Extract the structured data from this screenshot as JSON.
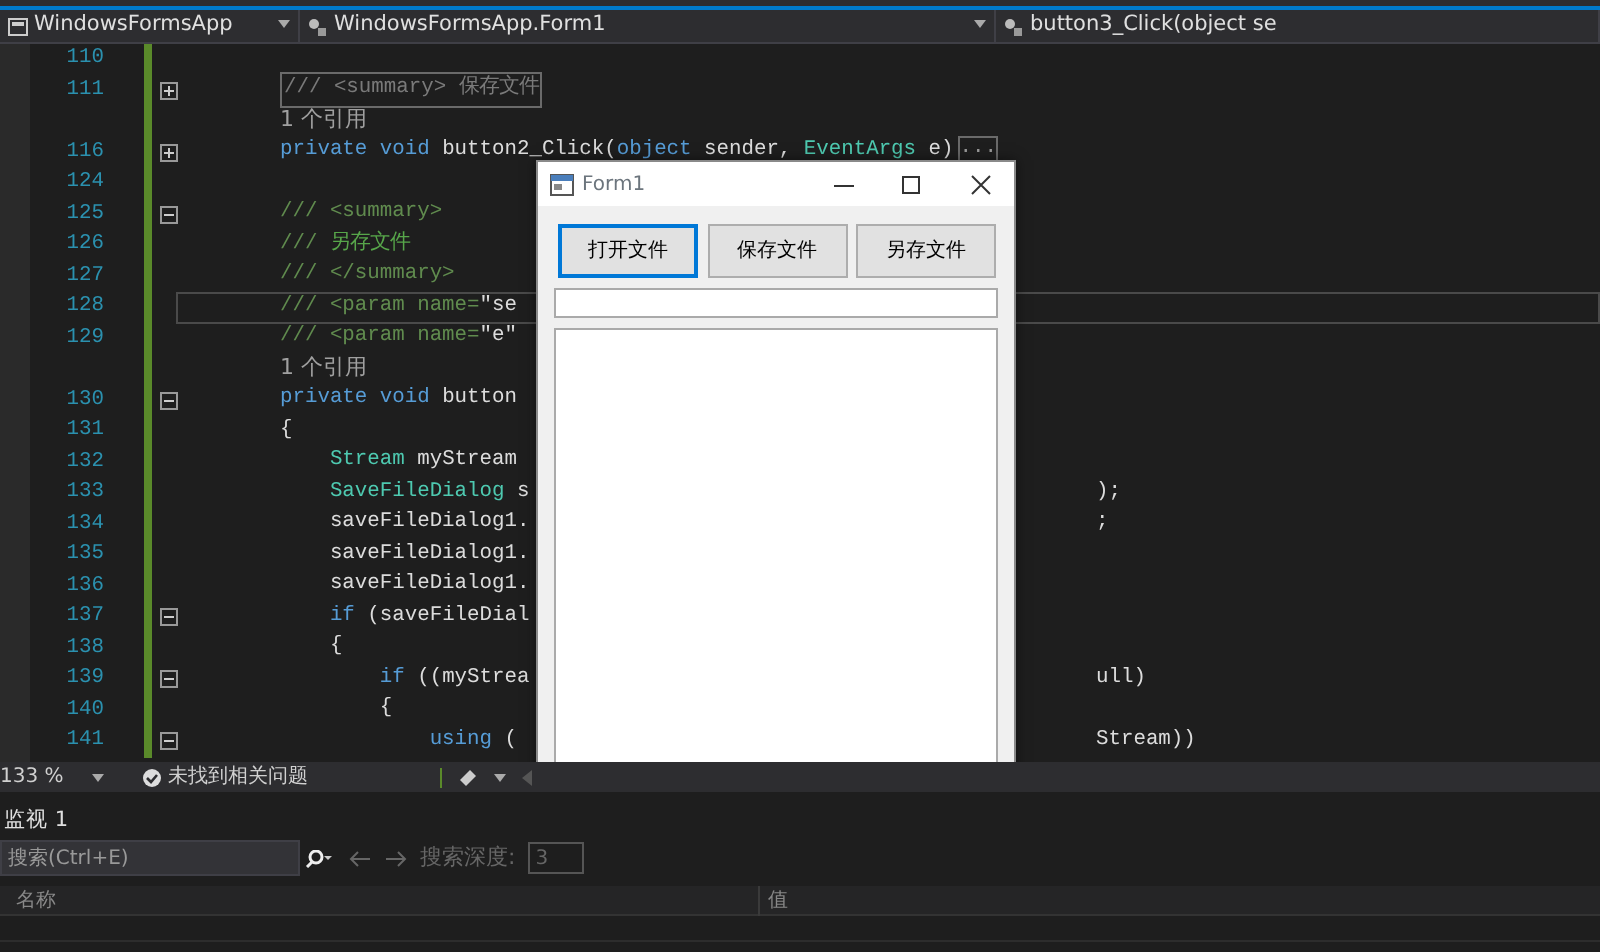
{
  "navigation_bar": {
    "project": "WindowsFormsApp",
    "class": "WindowsFormsApp.Form1",
    "member": "button3_Click(object se"
  },
  "editor": {
    "lines": [
      {
        "number": "110",
        "current": false
      },
      {
        "number": "111",
        "current": false,
        "expanded": false,
        "code": [
          {
            "text": "/// <summary> 保存文件",
            "kind": "collapsed"
          }
        ]
      },
      {
        "current": false,
        "code": [
          {
            "text": "1 个引用",
            "kind": "lens"
          }
        ]
      },
      {
        "number": "116",
        "current": false,
        "expanded": false,
        "code": [
          {
            "text": "private void ",
            "kind": "keyword"
          },
          {
            "text": "button2_Click(",
            "kind": "plain"
          },
          {
            "text": "object",
            "kind": "keyword"
          },
          {
            "text": " sender, ",
            "kind": "plain"
          },
          {
            "text": "EventArgs",
            "kind": "type"
          },
          {
            "text": " e)",
            "kind": "plain"
          }
        ],
        "hidden_body": "..."
      },
      {
        "number": "124",
        "current": false
      },
      {
        "number": "125",
        "current": false,
        "expanded": true,
        "code": [
          {
            "text": "/// <summary>",
            "kind": "doc"
          }
        ]
      },
      {
        "number": "126",
        "current": false,
        "code": [
          {
            "text": "/// ",
            "kind": "doc"
          },
          {
            "text": "另存文件",
            "kind": "comment"
          }
        ]
      },
      {
        "number": "127",
        "current": false,
        "code": [
          {
            "text": "/// </summary>",
            "kind": "doc"
          }
        ]
      },
      {
        "number": "128",
        "current": true,
        "code": [
          {
            "text": "/// <param name=",
            "kind": "doc"
          },
          {
            "text": "\"se",
            "kind": "plain"
          }
        ]
      },
      {
        "number": "129",
        "current": false,
        "code": [
          {
            "text": "/// <param name=",
            "kind": "doc"
          },
          {
            "text": "\"e\"",
            "kind": "plain"
          }
        ]
      },
      {
        "current": false,
        "code": [
          {
            "text": "1 个引用",
            "kind": "lens"
          }
        ]
      },
      {
        "number": "130",
        "current": false,
        "expanded": true,
        "code": [
          {
            "text": "private void ",
            "kind": "keyword"
          },
          {
            "text": "button",
            "kind": "plain"
          }
        ]
      },
      {
        "number": "131",
        "current": false,
        "code": [
          {
            "text": "{",
            "kind": "plain"
          }
        ]
      },
      {
        "number": "132",
        "current": false,
        "code": [
          {
            "text": "    Stream",
            "kind": "type"
          },
          {
            "text": " myStream",
            "kind": "plain"
          }
        ]
      },
      {
        "number": "133",
        "current": false,
        "code": [
          {
            "text": "    SaveFileDialog",
            "kind": "type"
          },
          {
            "text": " s",
            "kind": "plain"
          }
        ],
        "right": ");"
      },
      {
        "number": "134",
        "current": false,
        "code": [
          {
            "text": "    saveFileDialog1.",
            "kind": "plain"
          }
        ],
        "right": ";"
      },
      {
        "number": "135",
        "current": false,
        "code": [
          {
            "text": "    saveFileDialog1.",
            "kind": "plain"
          }
        ]
      },
      {
        "number": "136",
        "current": false,
        "code": [
          {
            "text": "    saveFileDialog1.",
            "kind": "plain"
          }
        ]
      },
      {
        "number": "137",
        "current": false,
        "expanded": true,
        "code": [
          {
            "text": "    if",
            "kind": "keyword"
          },
          {
            "text": " (saveFileDial",
            "kind": "plain"
          }
        ]
      },
      {
        "number": "138",
        "current": false,
        "code": [
          {
            "text": "    {",
            "kind": "plain"
          }
        ]
      },
      {
        "number": "139",
        "current": false,
        "expanded": true,
        "code": [
          {
            "text": "        if",
            "kind": "keyword"
          },
          {
            "text": " ((myStrea",
            "kind": "plain"
          }
        ],
        "right": "ull)"
      },
      {
        "number": "140",
        "current": false,
        "code": [
          {
            "text": "        {",
            "kind": "plain"
          }
        ]
      },
      {
        "number": "141",
        "current": false,
        "expanded": true,
        "code": [
          {
            "text": "            using",
            "kind": "keyword"
          },
          {
            "text": " (",
            "kind": "plain"
          }
        ],
        "right": "Stream))"
      }
    ]
  },
  "status": {
    "zoom": "133 %",
    "issues": "未找到相关问题"
  },
  "form": {
    "title": "Form1",
    "buttons": [
      {
        "label": "打开文件",
        "focused": true
      },
      {
        "label": "保存文件",
        "focused": false
      },
      {
        "label": "另存文件",
        "focused": false
      }
    ]
  },
  "watch": {
    "title": "监视 1",
    "search_placeholder": "搜索(Ctrl+E)",
    "depth_label": "搜索深度:",
    "depth_value": "3",
    "depth_disabled": true,
    "columns": [
      "名称",
      "值"
    ]
  }
}
